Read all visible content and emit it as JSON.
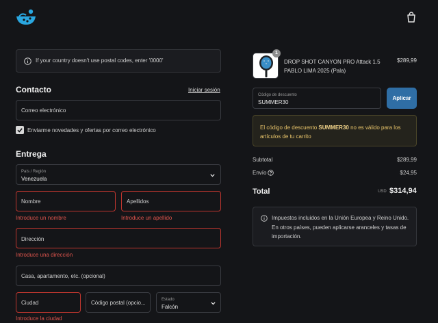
{
  "info_notice": "If your country doesn't use postal codes, enter '0000'",
  "contact": {
    "heading": "Contacto",
    "login_link": "Iniciar sesión",
    "email_placeholder": "Correo electrónico",
    "newsletter_label": "Enviarme novedades y ofertas por correo electrónico",
    "newsletter_checked": true
  },
  "delivery": {
    "heading": "Entrega",
    "country_label": "País / Región",
    "country_value": "Venezuela",
    "first_name_placeholder": "Nombre",
    "first_name_error": "Introduce un nombre",
    "last_name_placeholder": "Apellidos",
    "last_name_error": "Introduce un apellido",
    "address_placeholder": "Dirección",
    "address_error": "Introduce una dirección",
    "apartment_placeholder": "Casa, apartamento, etc. (opcional)",
    "city_placeholder": "Ciudad",
    "city_error": "Introduce la ciudad",
    "postal_placeholder": "Código postal (opcio...",
    "state_label": "Estado",
    "state_value": "Falcón"
  },
  "summary": {
    "quantity_badge": "1",
    "product_name": "DROP SHOT CANYON PRO Attack 1.5 PABLO LIMA 2025 (Pala)",
    "product_price": "$289,99",
    "discount_label": "Código de descuento",
    "discount_value": "SUMMER30",
    "apply_label": "Aplicar",
    "warning_before": "El código de descuento ",
    "warning_code": "SUMMER30",
    "warning_after": " no es válido para los artículos de tu carrito",
    "subtotal_label": "Subtotal",
    "subtotal_value": "$289,99",
    "shipping_label": "Envío",
    "shipping_value": "$24,95",
    "total_label": "Total",
    "total_currency": "USD",
    "total_value": "$314,94",
    "tax_notice": "Impuestos incluidos en la Unión Europea y Reino Unido. En otros países, pueden aplicarse aranceles y tasas de importación."
  },
  "colors": {
    "background": "#141518",
    "accent": "#2f6ea5",
    "logo": "#2aa7e0",
    "error": "#c0362f",
    "warning_text": "#e8c46a"
  },
  "icons": [
    "logo-icon",
    "cart-icon",
    "info-icon",
    "checkmark-icon",
    "chevron-down-icon",
    "help-icon"
  ]
}
